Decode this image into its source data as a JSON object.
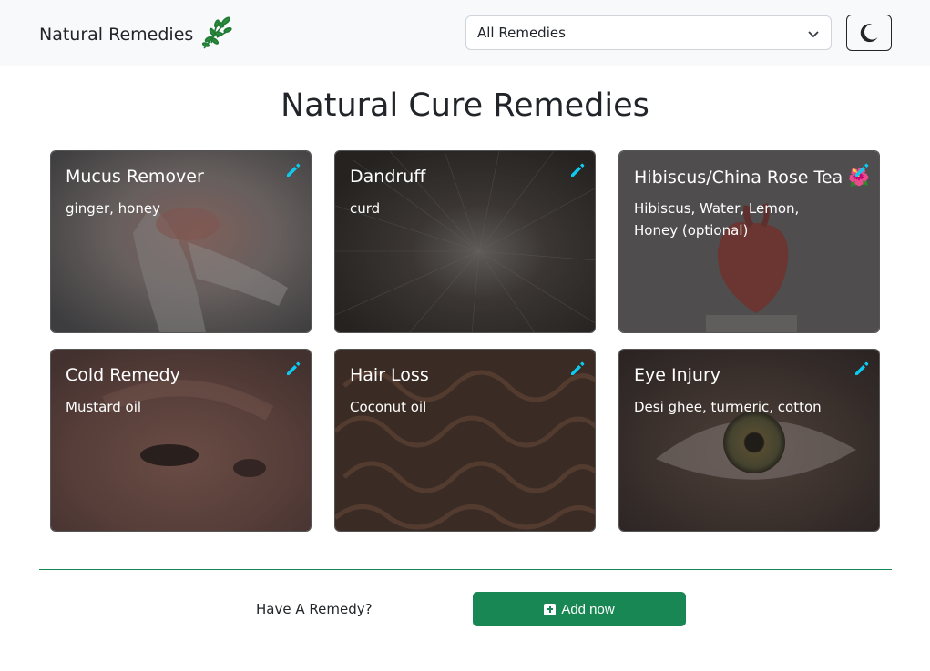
{
  "navbar": {
    "brand": "Natural Remedies",
    "brand_icon": "herb-leaves-icon",
    "filter": {
      "selected": "All Remedies"
    },
    "theme_toggle_icon": "moon-icon"
  },
  "page": {
    "title": "Natural Cure Remedies"
  },
  "cards": [
    {
      "title": "Mucus Remover",
      "description": "ginger, honey",
      "image": "throat-photo",
      "edit_icon": "pencil-icon"
    },
    {
      "title": "Dandruff",
      "description": "curd",
      "image": "scalp-hair-photo",
      "edit_icon": "pencil-icon"
    },
    {
      "title": "Hibiscus/China Rose Tea 🌺",
      "description": "Hibiscus, Water, Lemon, Honey (optional)",
      "image": "heart-model-photo",
      "edit_icon": "pencil-icon"
    },
    {
      "title": "Cold Remedy",
      "description": "Mustard oil",
      "image": "nose-photo",
      "edit_icon": "pencil-icon"
    },
    {
      "title": "Hair Loss",
      "description": "Coconut oil",
      "image": "curly-hair-photo",
      "edit_icon": "pencil-icon"
    },
    {
      "title": "Eye Injury",
      "description": "Desi ghee, turmeric, cotton",
      "image": "eye-photo",
      "edit_icon": "pencil-icon"
    }
  ],
  "footer": {
    "prompt": "Have A Remedy?",
    "add_button_label": "Add now",
    "add_button_icon": "plus-square-icon"
  },
  "colors": {
    "accent_green": "#198754",
    "edit_icon_blue": "#0dcaf0",
    "navbar_bg": "#f8f9fa"
  }
}
